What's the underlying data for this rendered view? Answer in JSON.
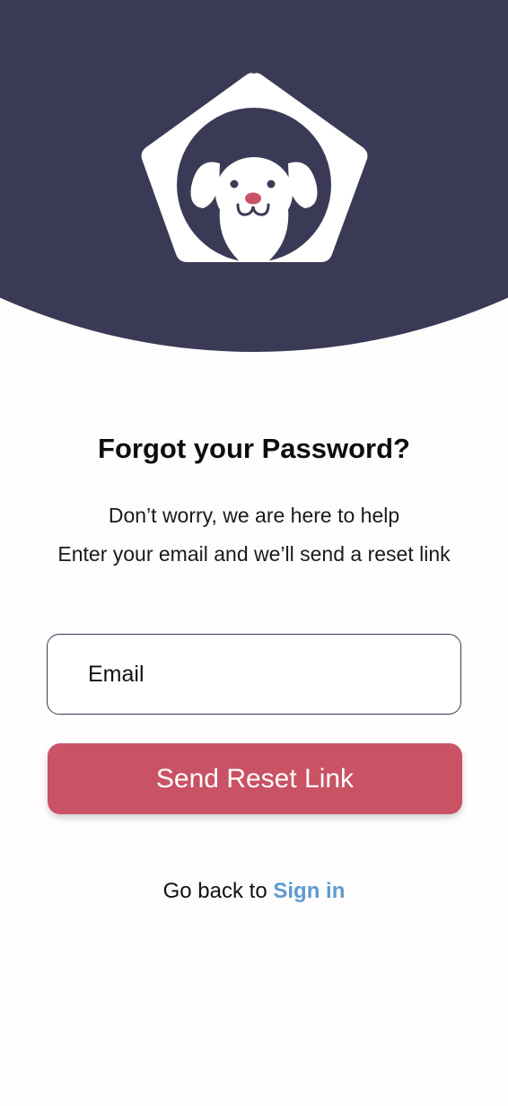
{
  "header": {
    "background_color": "#3b3a56",
    "logo": {
      "icon": "dog-house-icon",
      "colors": {
        "house": "#ffffff",
        "circle": "#3b3a56",
        "dog": "#ffffff",
        "nose": "#c95264"
      }
    }
  },
  "content": {
    "title": "Forgot your Password?",
    "subtitle_line1": "Don’t worry, we are here to help",
    "subtitle_line2": "Enter your email and we’ll send a reset link"
  },
  "form": {
    "email": {
      "placeholder": "Email",
      "value": ""
    },
    "submit_label": "Send Reset Link",
    "submit_color": "#c95264"
  },
  "footer": {
    "prefix": "Go back to",
    "link_label": "Sign in",
    "link_color": "#5d9bd0"
  }
}
